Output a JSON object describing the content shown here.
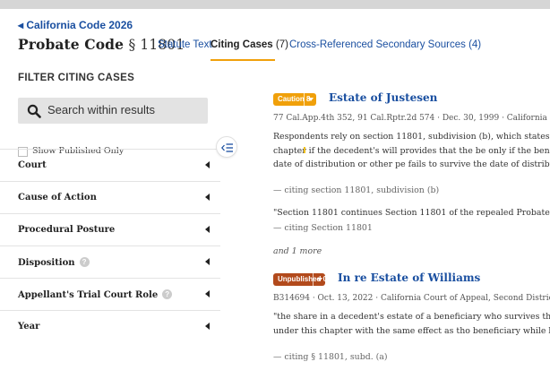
{
  "header": {
    "breadcrumb": "California Code 2026",
    "title_code": "Probate Code",
    "title_section": "§ 11801",
    "tabs": [
      {
        "label": "Statute Text"
      },
      {
        "label": "Citing Cases",
        "count": "(7)"
      },
      {
        "label": "Cross-Referenced Secondary Sources (4)"
      }
    ]
  },
  "sidebar": {
    "filter_title": "FILTER CITING CASES",
    "search_placeholder": "Search within results",
    "published_only_label": "Show Published Only",
    "facets": [
      {
        "label": "Court"
      },
      {
        "label": "Cause of Action"
      },
      {
        "label": "Procedural Posture"
      },
      {
        "label": "Disposition"
      },
      {
        "label": "Appellant's Trial Court Role"
      },
      {
        "label": "Year"
      }
    ]
  },
  "results": [
    {
      "badge": "Caution 8",
      "name": "Estate of Justesen",
      "meta": "77 Cal.App.4th 352, 91 Cal.Rptr.2d 574  ·  Dec. 30, 1999  ·  California Co",
      "quote1": "Respondents rely on section 11801, subdivision (b), which states in made under this chapter if the decedent's will provides that the be only if the beneficiary survives the date of distribution or other pe fails to survive the date of distribution or other period.\"",
      "cite1": "— citing section 11801, subdivision (b)",
      "quote2": "\"Section 11801 continues Section 11801 of the repealed Probate Coc",
      "cite2": "— citing Section 11801",
      "more": "and 1 more"
    },
    {
      "badge": "Unpublished 0",
      "name": "In re Estate of Williams",
      "meta": "B314694  ·  Oct. 13, 2022  ·  California Court of Appeal, Second Distric",
      "quote1": "\"the share in a decedent's estate of a beneficiary who survives the shall be distributed under this chapter with the same effect as tho beneficiary while living\"",
      "cite1": "— citing § 11801, subd. (a)"
    }
  ],
  "colors": {
    "link": "#1a4fa0",
    "caution": "#f0a00a",
    "unpublished": "#b24a1c",
    "tab_underline": "#f0a00a"
  }
}
